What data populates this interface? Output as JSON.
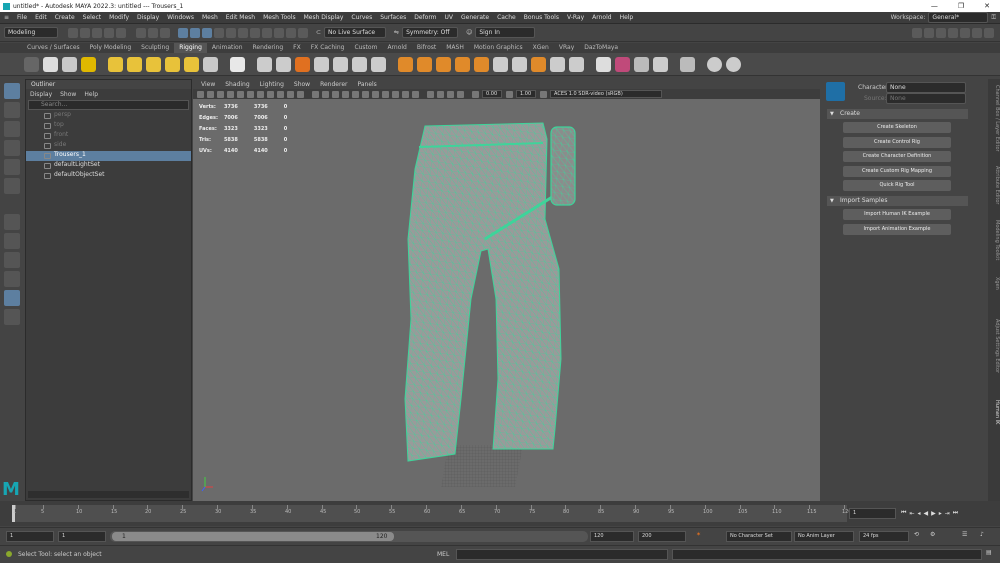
{
  "title": {
    "text": "untitled* - Autodesk MAYA 2022.3: untitled   ---   Trousers_1"
  },
  "menu": [
    "File",
    "Edit",
    "Create",
    "Select",
    "Modify",
    "Display",
    "Windows",
    "Mesh",
    "Edit Mesh",
    "Mesh Tools",
    "Mesh Display",
    "Curves",
    "Surfaces",
    "Deform",
    "UV",
    "Generate",
    "Cache",
    "Bonus Tools",
    "V-Ray",
    "Arnold",
    "Help"
  ],
  "workspace": {
    "label": "Workspace:",
    "value": "General*"
  },
  "status": {
    "mode": "Modeling",
    "live_surface": "No Live Surface",
    "symmetry": "Symmetry: Off",
    "sign_in": "Sign In"
  },
  "shelf_tabs": [
    "Curves / Surfaces",
    "Poly Modeling",
    "Sculpting",
    "Rigging",
    "Animation",
    "Rendering",
    "FX",
    "FX Caching",
    "Custom",
    "Arnold",
    "Bifrost",
    "MASH",
    "Motion Graphics",
    "XGen",
    "VRay",
    "DazToMaya"
  ],
  "shelf_active": "Rigging",
  "outliner": {
    "title": "Outliner",
    "menu": [
      "Display",
      "Show",
      "Help"
    ],
    "search_placeholder": "Search...",
    "items": [
      {
        "label": "persp",
        "dim": true
      },
      {
        "label": "top",
        "dim": true
      },
      {
        "label": "front",
        "dim": true
      },
      {
        "label": "side",
        "dim": true
      },
      {
        "label": "Trousers_1",
        "selected": true
      },
      {
        "label": "defaultLightSet"
      },
      {
        "label": "defaultObjectSet"
      }
    ]
  },
  "viewport": {
    "menu": [
      "View",
      "Shading",
      "Lighting",
      "Show",
      "Renderer",
      "Panels"
    ],
    "exposure": "0.00",
    "gamma": "1.00",
    "colorspace": "ACES 1.0 SDR-video (sRGB)",
    "hud": [
      [
        "Verts:",
        "3736",
        "3736",
        "0"
      ],
      [
        "Edges:",
        "7006",
        "7006",
        "0"
      ],
      [
        "Faces:",
        "3323",
        "3323",
        "0"
      ],
      [
        "Tris:",
        "5838",
        "5838",
        "0"
      ],
      [
        "UVs:",
        "4140",
        "4140",
        "0"
      ]
    ]
  },
  "hik": {
    "character_label": "Character:",
    "character_value": "None",
    "source_label": "Source:",
    "source_value": "None",
    "create_header": "Create",
    "create_buttons": [
      "Create Skeleton",
      "Create Control Rig",
      "Create Character Definition",
      "Create Custom Rig Mapping",
      "Quick Rig Tool"
    ],
    "import_header": "Import Samples",
    "import_buttons": [
      "Import Human IK Example",
      "Import Animation Example"
    ]
  },
  "side_tabs": [
    "Channel Box / Layer Editor",
    "Attribute Editor",
    "Modeling Toolkit",
    "Xgen",
    "Adjust Settings Editor",
    "Human IK"
  ],
  "timeline": {
    "ticks": [
      "1",
      "5",
      "10",
      "15",
      "20",
      "25",
      "30",
      "35",
      "40",
      "45",
      "50",
      "55",
      "60",
      "65",
      "70",
      "75",
      "80",
      "85",
      "90",
      "95",
      "100",
      "105",
      "110",
      "115",
      "120"
    ],
    "current_frame": "1"
  },
  "range": {
    "start": "1",
    "start2": "1",
    "slider_start": "1",
    "slider_end": "120",
    "end": "120",
    "end2": "200",
    "char_set": "No Character Set",
    "anim_layer": "No Anim Layer",
    "fps": "24 fps"
  },
  "cmd": {
    "lang": "MEL",
    "help": "Select Tool: select an object"
  }
}
